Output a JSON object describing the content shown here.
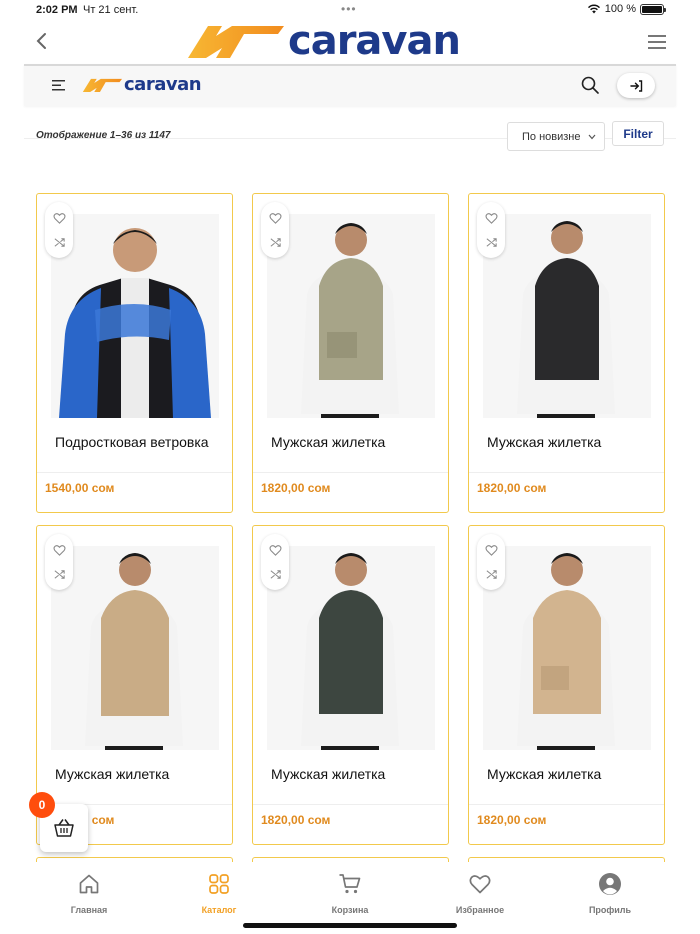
{
  "status_bar": {
    "time": "2:02 PM",
    "date": "Чт 21 сент.",
    "battery": "100 %"
  },
  "brand": {
    "name": "caravan",
    "color": "#1e3a8a",
    "accent": "#f2a024"
  },
  "toolbar": {
    "result_count": "Отображение 1–36 из 1147",
    "sort_selected": "По новизне",
    "filter_label": "Filter"
  },
  "products": [
    {
      "name": "Подростковая ветровка",
      "price": "1540,00 сом",
      "image": "boy-windbreaker"
    },
    {
      "name": "Мужская жилетка",
      "price": "1820,00 сом",
      "image": "man-vest-olive"
    },
    {
      "name": "Мужская жилетка",
      "price": "1820,00 сом",
      "image": "man-vest-black"
    },
    {
      "name": "Мужская жилетка",
      "price": "1820,00 сом",
      "image": "man-vest-beige"
    },
    {
      "name": "Мужская жилетка",
      "price": "1820,00 сом",
      "image": "man-vest-dark-green"
    },
    {
      "name": "Мужская жилетка",
      "price": "1820,00 сом",
      "image": "man-vest-sand"
    }
  ],
  "cart": {
    "count": "0"
  },
  "bottom_nav": [
    {
      "label": "Главная",
      "icon": "home-icon"
    },
    {
      "label": "Каталог",
      "icon": "grid-icon",
      "active": true
    },
    {
      "label": "Корзина",
      "icon": "cart-icon"
    },
    {
      "label": "Избранное",
      "icon": "heart-icon"
    },
    {
      "label": "Профиль",
      "icon": "user-icon"
    }
  ]
}
